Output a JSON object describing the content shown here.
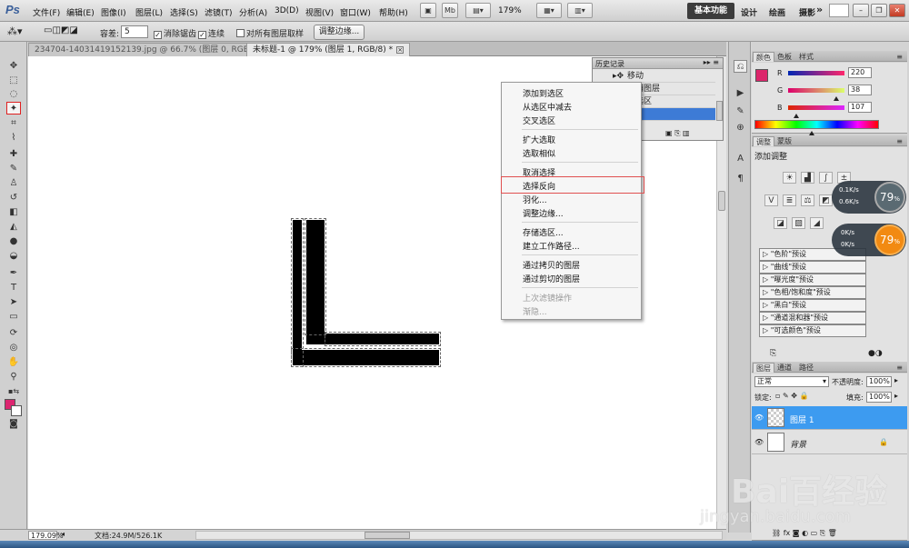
{
  "app": {
    "logo": "Ps"
  },
  "menu": [
    "文件(F)",
    "编辑(E)",
    "图像(I)",
    "图层(L)",
    "选择(S)",
    "滤镜(T)",
    "分析(A)",
    "3D(D)",
    "视图(V)",
    "窗口(W)",
    "帮助(H)"
  ],
  "menubar_extra": {
    "zoom": "179%",
    "workspace_active": "基本功能",
    "workspace_links": [
      "设计",
      "绘画",
      "摄影"
    ],
    "more": "»"
  },
  "options": {
    "tolerance_label": "容差:",
    "tolerance_value": "5",
    "antialias_label": "消除锯齿",
    "contiguous_label": "连续",
    "sample_all_label": "对所有图层取样",
    "refine_button": "调整边缘..."
  },
  "doc_tabs": [
    {
      "label": "234704-14031419152139.jpg @ 66.7% (图层 0, RGB/8#) *"
    },
    {
      "label": "未标题-1 @ 179% (图层 1, RGB/8) *"
    }
  ],
  "history": {
    "title": "历史记录",
    "rows": [
      "移动",
      "取消图层",
      "移选区"
    ]
  },
  "context_menu": {
    "items": [
      "添加到选区",
      "从选区中减去",
      "交叉选区",
      "扩大选取",
      "选取相似",
      "取消选择",
      "选择反向",
      "羽化...",
      "调整边缘...",
      "存储选区...",
      "建立工作路径...",
      "通过拷贝的图层",
      "通过剪切的图层",
      "上次滤镜操作",
      "渐隐..."
    ],
    "highlighted": "选择反向"
  },
  "color_panel": {
    "tabs": [
      "颜色",
      "色板",
      "样式"
    ],
    "r_label": "R",
    "g_label": "G",
    "b_label": "B",
    "r": "220",
    "g": "38",
    "b": "107",
    "r_num": 220,
    "g_num": 38,
    "b_num": 107,
    "swatch_color": "#dc266b"
  },
  "adjust_panel": {
    "tabs": [
      "调整",
      "蒙版"
    ],
    "title": "添加调整",
    "presets": [
      "\"色阶\"预设",
      "\"曲线\"预设",
      "\"曝光度\"预设",
      "\"色相/饱和度\"预设",
      "\"黑白\"预设",
      "\"通道混和器\"预设",
      "\"可选颜色\"预设"
    ]
  },
  "speed_widgets": [
    {
      "up": "0.1K/s",
      "down": "0.6K/s",
      "percent": "79",
      "unit": "%"
    },
    {
      "up": "0K/s",
      "down": "0K/s",
      "percent": "79",
      "unit": "%"
    }
  ],
  "layers_panel": {
    "tabs": [
      "图层",
      "通道",
      "路径"
    ],
    "blend_mode": "正常",
    "opacity_label": "不透明度:",
    "opacity": "100%",
    "lock_label": "锁定:",
    "fill_label": "填充:",
    "fill": "100%",
    "layers": [
      {
        "name": "图层 1",
        "selected": true
      },
      {
        "name": "背景",
        "selected": false
      }
    ]
  },
  "status": {
    "zoom": "179.09%",
    "doc_info": "文档:24.9M/526.1K"
  },
  "watermark": {
    "text": "Bai百经验",
    "sub": "jingyan.baidu.com"
  }
}
